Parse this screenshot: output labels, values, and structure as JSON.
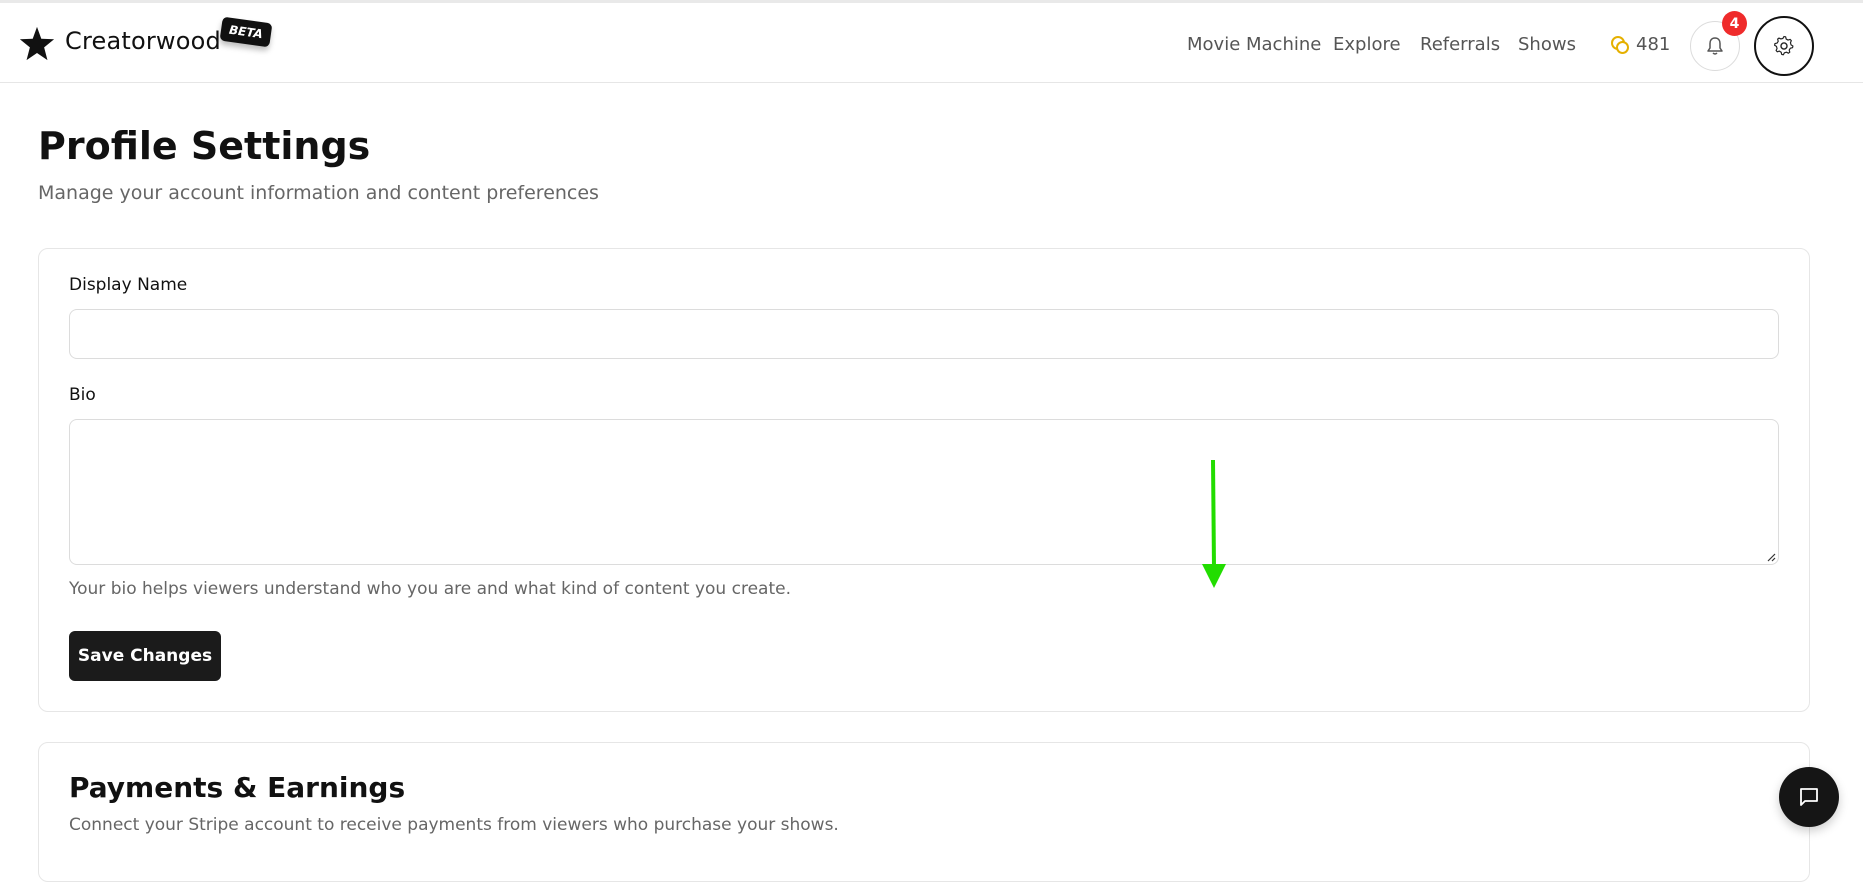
{
  "header": {
    "brand": "Creatorwood",
    "beta": "BETA",
    "nav": [
      "Movie Machine",
      "Explore",
      "Referrals",
      "Shows"
    ],
    "credits": "481",
    "notification_count": "4",
    "icons": {
      "logo": "star-icon",
      "credits": "coins-icon",
      "notifications": "bell-icon",
      "settings": "gear-icon",
      "chat": "chat-icon"
    }
  },
  "page": {
    "title": "Profile Settings",
    "subtitle": "Manage your account information and content preferences"
  },
  "profile_form": {
    "display_name_label": "Display Name",
    "display_name_value": "",
    "bio_label": "Bio",
    "bio_value": "",
    "bio_help": "Your bio helps viewers understand who you are and what kind of content you create.",
    "save_label": "Save Changes"
  },
  "payments": {
    "title": "Payments & Earnings",
    "subtitle": "Connect your Stripe account to receive payments from viewers who purchase your shows."
  },
  "colors": {
    "accent": "#111111",
    "badge": "#ef2b2b",
    "coin": "#e5b000",
    "annotation_arrow": "#22dd00"
  }
}
